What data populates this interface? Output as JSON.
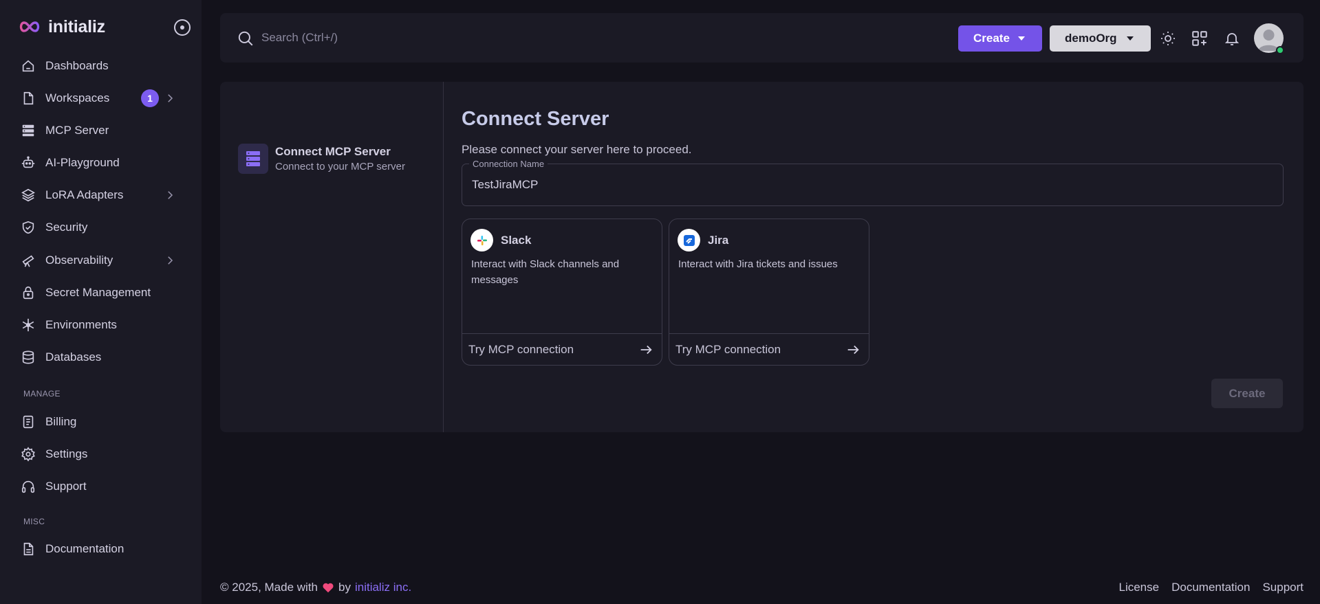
{
  "brand": {
    "name": "initializ"
  },
  "sidebar": {
    "items": [
      {
        "label": "Dashboards"
      },
      {
        "label": "Workspaces",
        "badge": "1"
      },
      {
        "label": "MCP Server"
      },
      {
        "label": "AI-Playground"
      },
      {
        "label": "LoRA Adapters"
      },
      {
        "label": "Security"
      },
      {
        "label": "Observability"
      },
      {
        "label": "Secret Management"
      },
      {
        "label": "Environments"
      },
      {
        "label": "Databases"
      }
    ],
    "manage_label": "MANAGE",
    "manage_items": [
      {
        "label": "Billing"
      },
      {
        "label": "Settings"
      },
      {
        "label": "Support"
      }
    ],
    "misc_label": "MISC",
    "misc_items": [
      {
        "label": "Documentation"
      }
    ]
  },
  "topbar": {
    "search_placeholder": "Search (Ctrl+/)",
    "create_label": "Create",
    "org_label": "demoOrg"
  },
  "stepper": {
    "title": "Connect MCP Server",
    "subtitle": "Connect to your MCP server"
  },
  "main": {
    "title": "Connect Server",
    "description": "Please connect your server here to proceed.",
    "connection_name_label": "Connection Name",
    "connection_name_value": "TestJiraMCP",
    "cards": [
      {
        "title": "Slack",
        "description": "Interact with Slack channels and messages",
        "action": "Try MCP connection"
      },
      {
        "title": "Jira",
        "description": "Interact with Jira tickets and issues",
        "action": "Try MCP connection"
      }
    ],
    "create_button": "Create"
  },
  "footer": {
    "copyright": "© 2025, Made with",
    "by": "by",
    "company": "initializ inc.",
    "links": [
      "License",
      "Documentation",
      "Support"
    ]
  },
  "colors": {
    "accent": "#7453e8",
    "background": "#13121b",
    "surface": "#1b1a25"
  }
}
